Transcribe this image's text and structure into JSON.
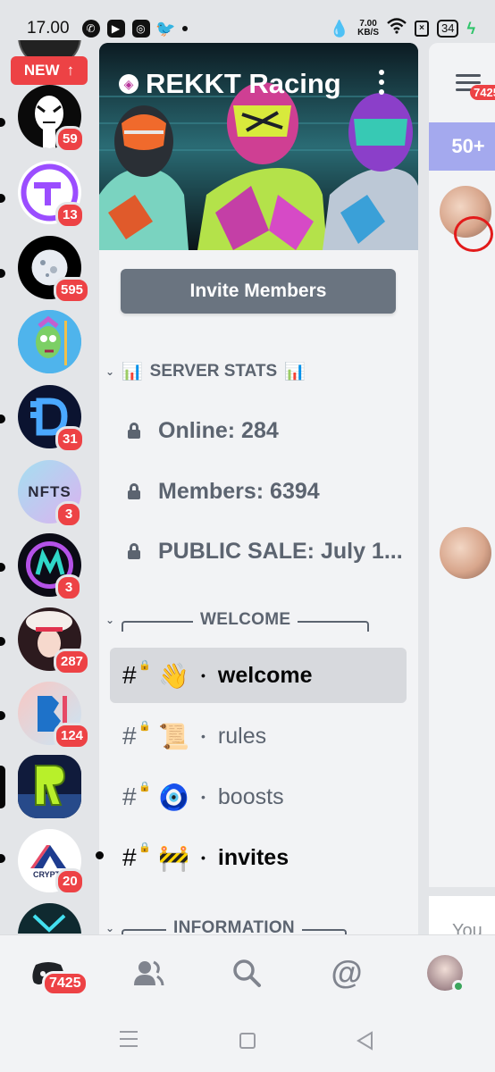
{
  "status_bar": {
    "time": "17.00",
    "net_speed": "7.00",
    "net_unit": "KB/S",
    "battery": "34"
  },
  "rail": {
    "new_label": "NEW",
    "servers": [
      {
        "badge": "59"
      },
      {
        "badge": "13"
      },
      {
        "badge": "595"
      },
      {
        "badge": ""
      },
      {
        "badge": "31"
      },
      {
        "badge": "3",
        "logo_text": "NFTS"
      },
      {
        "badge": "3"
      },
      {
        "badge": "287"
      },
      {
        "badge": "124"
      },
      {
        "badge": ""
      },
      {
        "badge": "20",
        "logo_text": "CRYPTO"
      }
    ]
  },
  "server": {
    "name": "REKKT Racing",
    "invite_label": "Invite Members"
  },
  "categories": {
    "stats": "SERVER STATS",
    "welcome": "WELCOME",
    "information": "INFORMATION"
  },
  "stats": [
    {
      "label": "Online: 284"
    },
    {
      "label": "Members: 6394"
    },
    {
      "label": "PUBLIC SALE: July 1..."
    }
  ],
  "channels": [
    {
      "emoji": "👋",
      "name": "welcome",
      "state": "active"
    },
    {
      "emoji": "📜",
      "name": "rules",
      "state": "read"
    },
    {
      "emoji": "🧿",
      "name": "boosts",
      "state": "read"
    },
    {
      "emoji": "🚧",
      "name": "invites",
      "state": "unread"
    }
  ],
  "peek": {
    "badge": "7425",
    "new_messages": "50+",
    "footer_text": "You"
  },
  "bottom_nav": {
    "home_badge": "7425"
  },
  "colors": {
    "accent_red": "#ed4245",
    "blurple_light": "#a4a9ee",
    "invite_button": "#6a7480"
  }
}
